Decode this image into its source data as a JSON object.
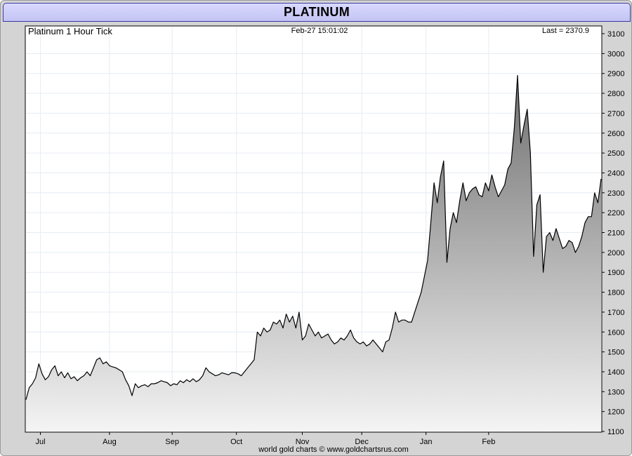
{
  "title": "PLATINUM",
  "subtitle": "Platinum 1 Hour Tick",
  "timestamp": "Feb-27  15:01:02",
  "last_label": "Last = 2370.9",
  "footer": "world gold charts © www.goldchartsrus.com",
  "colors": {
    "title_bg": "#c9c9f8",
    "line": "#000000",
    "fill_top": "#6f6f6f",
    "fill_bottom": "#f4f4f4",
    "grid": "#e6ecf2"
  },
  "chart_data": {
    "type": "area",
    "title": "Platinum 1 Hour Tick",
    "xlabel": "",
    "ylabel": "",
    "ylim": [
      1100,
      3100
    ],
    "y_ticks": [
      3100,
      3000,
      2900,
      2800,
      2700,
      2600,
      2500,
      2400,
      2300,
      2200,
      2100,
      2000,
      1900,
      1800,
      1700,
      1600,
      1500,
      1400,
      1300,
      1200,
      1100
    ],
    "x_ticks": [
      "Jul",
      "Aug",
      "Sep",
      "Oct",
      "Nov",
      "Dec",
      "Jan",
      "Feb"
    ],
    "x_tick_index": [
      4.5,
      26,
      45.5,
      65.5,
      86,
      104.5,
      124.5,
      144
    ],
    "grid": true,
    "series": [
      {
        "values": [
          1260,
          1320,
          1340,
          1370,
          1440,
          1390,
          1360,
          1375,
          1410,
          1430,
          1380,
          1400,
          1370,
          1395,
          1365,
          1375,
          1355,
          1370,
          1380,
          1400,
          1380,
          1420,
          1460,
          1470,
          1440,
          1450,
          1430,
          1425,
          1420,
          1410,
          1400,
          1360,
          1330,
          1280,
          1340,
          1320,
          1330,
          1335,
          1325,
          1340,
          1340,
          1345,
          1355,
          1350,
          1345,
          1330,
          1340,
          1335,
          1355,
          1345,
          1360,
          1350,
          1365,
          1350,
          1360,
          1380,
          1420,
          1400,
          1390,
          1380,
          1385,
          1395,
          1390,
          1385,
          1395,
          1395,
          1390,
          1380,
          1400,
          1420,
          1440,
          1460,
          1600,
          1580,
          1620,
          1600,
          1610,
          1650,
          1640,
          1660,
          1620,
          1690,
          1650,
          1680,
          1620,
          1700,
          1560,
          1580,
          1640,
          1610,
          1580,
          1600,
          1570,
          1580,
          1590,
          1560,
          1540,
          1550,
          1570,
          1560,
          1580,
          1610,
          1570,
          1550,
          1540,
          1550,
          1530,
          1540,
          1560,
          1540,
          1520,
          1500,
          1550,
          1560,
          1620,
          1700,
          1650,
          1660,
          1660,
          1650,
          1650,
          1700,
          1750,
          1800,
          1880,
          1960,
          2150,
          2350,
          2250,
          2380,
          2460,
          1950,
          2120,
          2200,
          2150,
          2260,
          2350,
          2260,
          2300,
          2320,
          2330,
          2290,
          2280,
          2350,
          2310,
          2390,
          2330,
          2280,
          2310,
          2340,
          2420,
          2450,
          2630,
          2890,
          2550,
          2640,
          2720,
          2500,
          1980,
          2240,
          2290,
          1900,
          2080,
          2100,
          2060,
          2120,
          2070,
          2020,
          2030,
          2060,
          2050,
          2000,
          2030,
          2080,
          2150,
          2180,
          2180,
          2300,
          2250,
          2370
        ]
      }
    ]
  }
}
